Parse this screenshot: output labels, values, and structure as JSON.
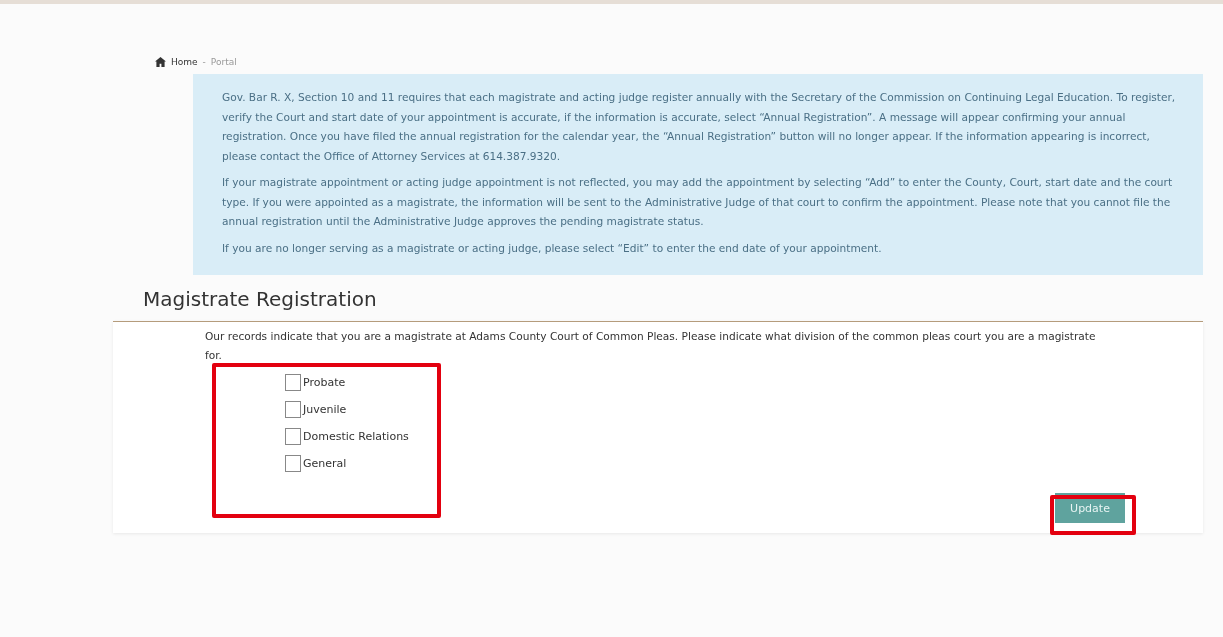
{
  "breadcrumb": {
    "home": "Home",
    "separator": "-",
    "current": "Portal"
  },
  "notice": [
    "Gov. Bar R. X, Section 10 and 11 requires that each magistrate and acting judge register annually with the Secretary of the Commission on Continuing Legal Education. To register, verify the Court and start date of your appointment is accurate, if the information is accurate, select “Annual Registration”. A message will appear confirming your annual registration. Once you have filed the annual registration for the calendar year, the “Annual Registration” button will no longer appear. If the information appearing is incorrect, please contact the Office of Attorney Services at 614.387.9320.",
    "If your magistrate appointment or acting judge appointment is not reflected, you may add the appointment by selecting “Add” to enter the County, Court, start date and the court type. If you were appointed as a magistrate, the information will be sent to the Administrative Judge of that court to confirm the appointment. Please note that you cannot file the annual registration until the Administrative Judge approves the pending magistrate status.",
    "If you are no longer serving as a magistrate or acting judge, please select “Edit” to enter the end date of your appointment."
  ],
  "heading": "Magistrate Registration",
  "intro": "Our records indicate that you are a magistrate at Adams County Court of Common Pleas. Please indicate what division of the common pleas court you are a magistrate for.",
  "divisions": [
    {
      "label": "Probate",
      "checked": false
    },
    {
      "label": "Juvenile",
      "checked": false
    },
    {
      "label": "Domestic Relations",
      "checked": false
    },
    {
      "label": "General",
      "checked": false
    }
  ],
  "button": "Update"
}
